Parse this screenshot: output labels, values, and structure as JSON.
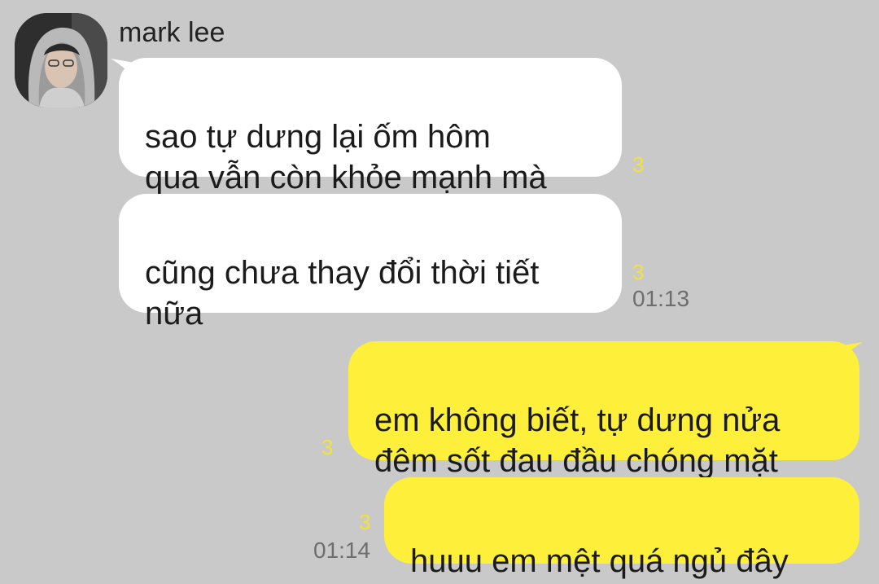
{
  "contact": {
    "name": "mark lee",
    "avatar_icon": "avatar-photo"
  },
  "messages": [
    {
      "side": "incoming",
      "text": "sao tự dưng lại ốm hôm\nqua vẫn còn khỏe mạnh mà",
      "unread": "3",
      "time": ""
    },
    {
      "side": "incoming",
      "text": "cũng chưa thay đổi thời tiết\nnữa",
      "unread": "3",
      "time": "01:13"
    },
    {
      "side": "outgoing",
      "text": "em không biết, tự dưng nửa\nđêm sốt đau đầu chóng mặt",
      "unread": "3",
      "time": ""
    },
    {
      "side": "outgoing",
      "text": "huuu em mệt quá ngủ đây",
      "unread": "3",
      "time": "01:14"
    }
  ],
  "colors": {
    "background": "#c9c9c9",
    "incoming_bubble": "#ffffff",
    "outgoing_bubble": "#fef03a",
    "unread_count": "#f2e33a",
    "timestamp": "#6e6e6e"
  }
}
